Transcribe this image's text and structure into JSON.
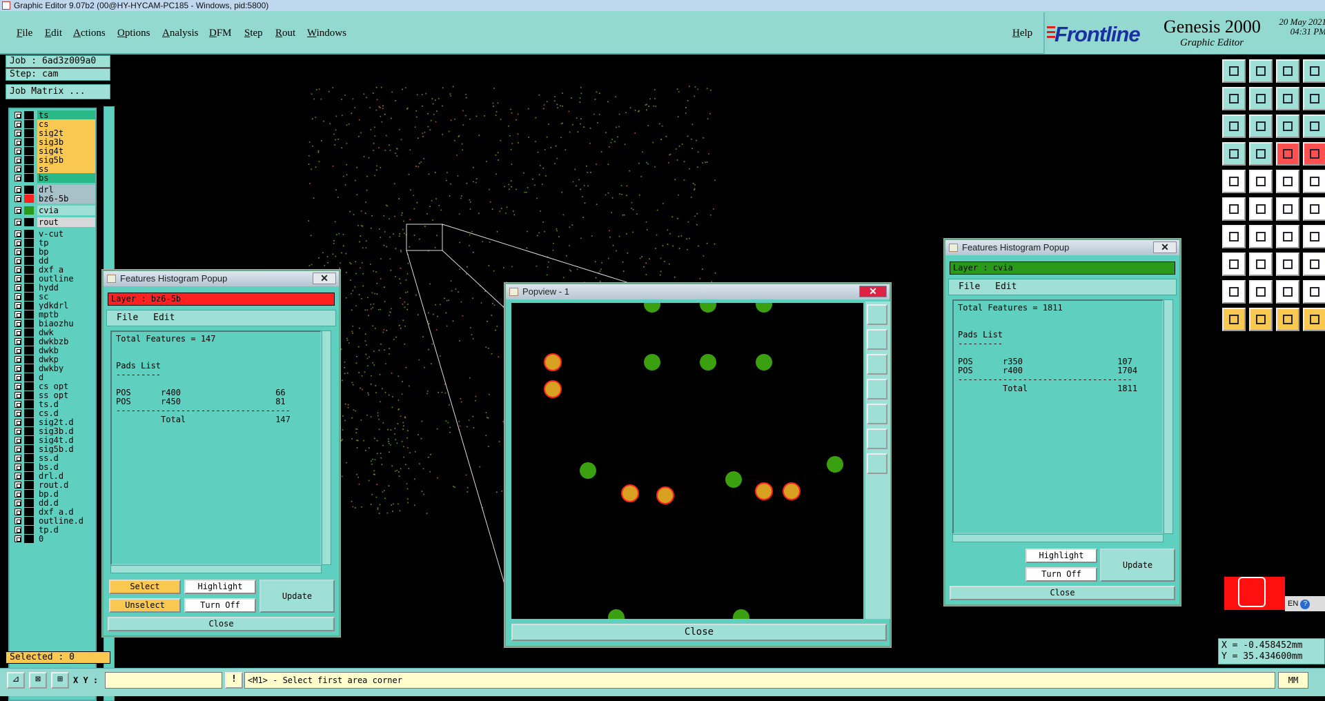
{
  "window": {
    "title": "Graphic Editor 9.07b2 (00@HY-HYCAM-PC185 - Windows, pid:5800)"
  },
  "menu": {
    "items": [
      "File",
      "Edit",
      "Actions",
      "Options",
      "Analysis",
      "DFM",
      "Step",
      "Rout",
      "Windows"
    ],
    "help": "Help"
  },
  "brand": {
    "logo": "Frontline",
    "product": "Genesis 2000",
    "subtitle": "Graphic Editor",
    "date": "20 May 2021",
    "time": "04:31 PM"
  },
  "job": {
    "job_label": "Job : 6ad3z009a0",
    "step_label": "Step: cam",
    "matrix_button": "Job Matrix ..."
  },
  "layers": [
    {
      "name": "ts",
      "color": "#2bb888",
      "sw": "#000"
    },
    {
      "name": "cs",
      "color": "#f8c850",
      "sw": "#000"
    },
    {
      "name": "sig2t",
      "color": "#f8c850",
      "sw": "#000"
    },
    {
      "name": "sig3b",
      "color": "#f8c850",
      "sw": "#000"
    },
    {
      "name": "sig4t",
      "color": "#f8c850",
      "sw": "#000"
    },
    {
      "name": "sig5b",
      "color": "#f8c850",
      "sw": "#000"
    },
    {
      "name": "ss",
      "color": "#f8c850",
      "sw": "#000"
    },
    {
      "name": "bs",
      "color": "#2bb888",
      "sw": "#000"
    },
    {
      "name": "drl",
      "color": "#a8c0c8",
      "sw": "#000"
    },
    {
      "name": "bz6-5b",
      "color": "#a8c0c8",
      "sw": "#ff2020"
    },
    {
      "name": "cvia",
      "color": "#9fe0d6",
      "sw": "#2a9a1a"
    },
    {
      "name": "rout",
      "color": "#d8d8d8",
      "sw": "#000"
    },
    {
      "name": "v-cut"
    },
    {
      "name": "tp"
    },
    {
      "name": "bp"
    },
    {
      "name": "dd"
    },
    {
      "name": "dxf_a"
    },
    {
      "name": "outline"
    },
    {
      "name": "hydd"
    },
    {
      "name": "sc"
    },
    {
      "name": "ydkdrl"
    },
    {
      "name": "mptb"
    },
    {
      "name": "biaozhu"
    },
    {
      "name": "dwk"
    },
    {
      "name": "dwkbzb"
    },
    {
      "name": "dwkb"
    },
    {
      "name": "dwkp"
    },
    {
      "name": "dwkby"
    },
    {
      "name": "d"
    },
    {
      "name": "cs_opt"
    },
    {
      "name": "ss_opt"
    },
    {
      "name": "ts.d"
    },
    {
      "name": "cs.d"
    },
    {
      "name": "sig2t.d"
    },
    {
      "name": "sig3b.d"
    },
    {
      "name": "sig4t.d"
    },
    {
      "name": "sig5b.d"
    },
    {
      "name": "ss.d"
    },
    {
      "name": "bs.d"
    },
    {
      "name": "drl.d"
    },
    {
      "name": "rout.d"
    },
    {
      "name": "bp.d"
    },
    {
      "name": "dd.d"
    },
    {
      "name": "dxf_a.d"
    },
    {
      "name": "outline.d"
    },
    {
      "name": "tp.d"
    },
    {
      "name": "0"
    }
  ],
  "selected": "Selected : 0",
  "hist_left": {
    "title": "Features Histogram Popup",
    "layer": "Layer : bz6-5b",
    "layer_color": "#ff2020",
    "menu": [
      "File",
      "Edit"
    ],
    "text": "Total Features = 147\n\n\nPads List\n---------\n\nPOS      r400                   66\nPOS      r450                   81\n-----------------------------------\n         Total                  147",
    "buttons": {
      "select": "Select",
      "unselect": "Unselect",
      "highlight": "Highlight",
      "turn_off": "Turn Off",
      "update": "Update",
      "close": "Close"
    }
  },
  "hist_right": {
    "title": "Features Histogram Popup",
    "layer": "Layer : cvia",
    "layer_color": "#2a9a1a",
    "menu": [
      "File",
      "Edit"
    ],
    "text": "Total Features = 1811\n\n\nPads List\n---------\n\nPOS      r350                   107\nPOS      r400                   1704\n-----------------------------------\n         Total                  1811",
    "buttons": {
      "highlight": "Highlight",
      "turn_off": "Turn Off",
      "update": "Update",
      "close": "Close"
    }
  },
  "popview": {
    "title": "Popview - 1",
    "close": "Close"
  },
  "coords": {
    "x": "X = -0.458452mm",
    "y": "Y = 35.434600mm"
  },
  "status": {
    "xy_label": "X Y :",
    "message": "<M1> - Select first area corner",
    "units": "MM"
  },
  "tray": {
    "lang": "EN"
  }
}
